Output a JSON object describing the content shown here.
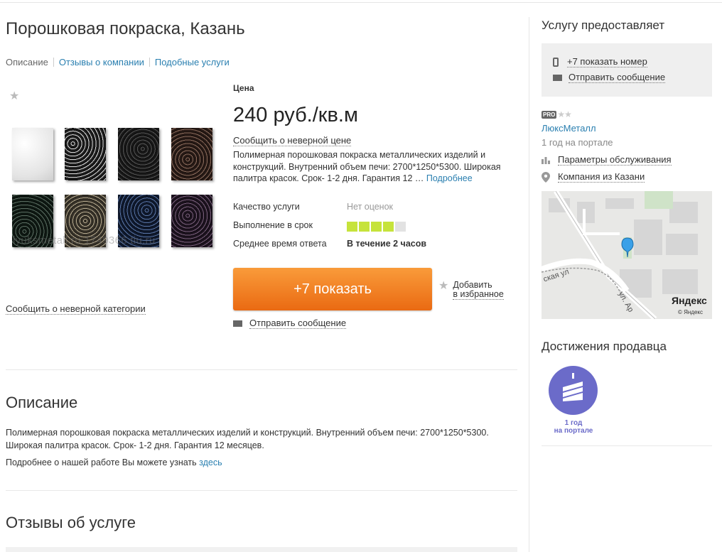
{
  "title": "Порошковая покраска, Казань",
  "tabs": [
    {
      "label": "Описание"
    },
    {
      "label": "Отзывы о компании"
    },
    {
      "label": "Подобные услуги"
    }
  ],
  "gallery": {
    "watermark": "lyuksmetall.ru 1749366.tiu.ru",
    "wrong_category": "Сообщить о неверной категории",
    "swatches": [
      "white-texture",
      "black-white-texture",
      "dark-grey-texture",
      "bronze-texture",
      "dark-green-texture",
      "beige-texture",
      "blue-texture",
      "purple-texture"
    ]
  },
  "offer": {
    "price_label": "Цена",
    "price": "240 руб./кв.м",
    "wrong_price": "Сообщить о неверной цене",
    "short_description": "Полимерная порошковая покраска металлических изделий и конструкций. Внутренний объем печи: 2700*1250*5300. Широкая палитра красок. Срок- 1-2 дня. Гарантия 12 …",
    "more_link": "Подробнее",
    "stats": [
      {
        "label": "Качество услуги",
        "value": "Нет оценок"
      },
      {
        "label": "Выполнение в срок",
        "rating": 4,
        "rating_max": 5
      },
      {
        "label": "Среднее время ответа",
        "value": "В течение 2 часов"
      }
    ],
    "colors": {
      "rating_on": "#c6e33b",
      "rating_off": "#e2e2e2",
      "button_accent": "#f0781c",
      "link": "#2a7fb0"
    },
    "show_button": "+7 показать",
    "favorite_line1": "Добавить",
    "favorite_line2": "в избранное",
    "send_message": "Отправить сообщение"
  },
  "description": {
    "heading": "Описание",
    "text": "Полимерная порошковая покраска металлических изделий и конструкций. Внутренний объем печи: 2700*1250*5300. Широкая палитра красок. Срок- 1-2 дня. Гарантия 12 месяцев.",
    "more_prefix": "Подробнее о нашей работе Вы можете узнать",
    "more_link": "здесь"
  },
  "reviews": {
    "heading": "Отзывы об услуге"
  },
  "sidebar": {
    "title": "Услугу предоставляет",
    "show_phone": "+7 показать номер",
    "send_message": "Отправить сообщение",
    "pro_badge": "PRO",
    "company_name": "ЛюксМеталл",
    "years": "1 год на портале",
    "service_params": "Параметры обслуживания",
    "company_city": "Компания из Казани",
    "map": {
      "street_left": "ская ул",
      "street_bottom": "ул. Ар",
      "logo": "Яндекс",
      "copyright": "© Яндекс"
    },
    "achievements_title": "Достижения продавца",
    "achievement_line1": "1 год",
    "achievement_line2": "на портале"
  }
}
